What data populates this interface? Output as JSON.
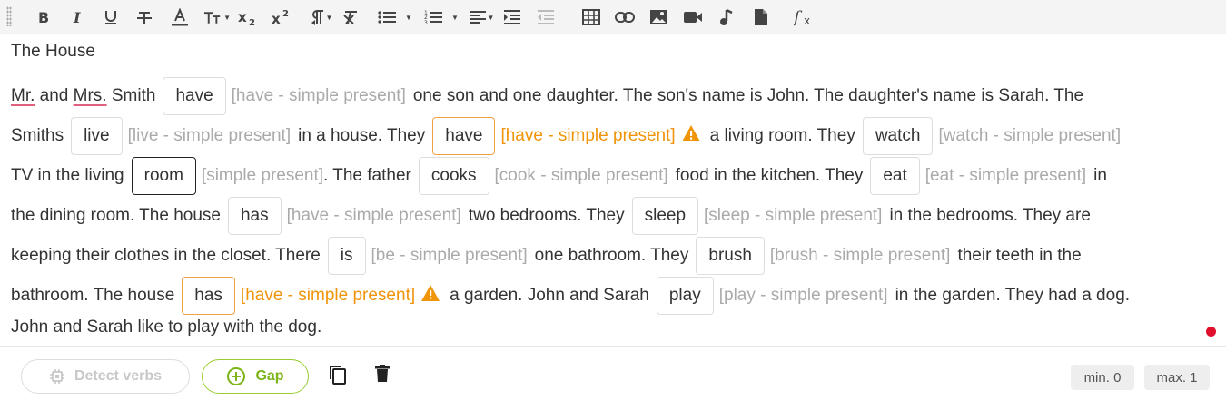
{
  "toolbar": {
    "items": [
      "bold-icon",
      "italic-icon",
      "underline-icon",
      "strikethrough-icon",
      "font-color-icon",
      "font-size-icon",
      "subscript-icon",
      "superscript-icon",
      "paragraph-format-icon",
      "clear-formatting-icon",
      "unordered-list-icon",
      "ordered-list-icon",
      "align-icon",
      "indent-icon",
      "outdent-icon",
      "table-icon",
      "link-icon",
      "image-icon",
      "video-icon",
      "audio-icon",
      "file-icon",
      "formula-icon"
    ]
  },
  "editor": {
    "title": "The House",
    "lines": [
      [
        {
          "t": "text",
          "v": "Mr.",
          "u": true
        },
        {
          "t": "text",
          "v": " and "
        },
        {
          "t": "text",
          "v": "Mrs.",
          "u": true
        },
        {
          "t": "text",
          "v": " Smith"
        },
        {
          "t": "gap",
          "v": "have"
        },
        {
          "t": "hint",
          "v": "[have - simple present]"
        },
        {
          "t": "text",
          "v": "one son and one daughter. The son's name is John. The daughter's name is Sarah. The"
        }
      ],
      [
        {
          "t": "text",
          "v": "Smiths"
        },
        {
          "t": "gap",
          "v": "live"
        },
        {
          "t": "hint",
          "v": "[live - simple present]"
        },
        {
          "t": "text",
          "v": "in a house. They"
        },
        {
          "t": "gap",
          "v": "have",
          "s": "orange"
        },
        {
          "t": "hint",
          "v": "[have - simple present]",
          "s": "orange"
        },
        {
          "t": "warn"
        },
        {
          "t": "text",
          "v": "a living room. They"
        },
        {
          "t": "gap",
          "v": "watch"
        },
        {
          "t": "hint",
          "v": "[watch - simple present]"
        }
      ],
      [
        {
          "t": "text",
          "v": "TV in the living"
        },
        {
          "t": "gap",
          "v": "room",
          "s": "focus"
        },
        {
          "t": "hint",
          "v": "[simple present]",
          "nm": true
        },
        {
          "t": "text",
          "v": ". The father"
        },
        {
          "t": "gap",
          "v": "cooks"
        },
        {
          "t": "hint",
          "v": "[cook - simple present]"
        },
        {
          "t": "text",
          "v": "food in the kitchen. They"
        },
        {
          "t": "gap",
          "v": "eat"
        },
        {
          "t": "hint",
          "v": "[eat - simple present]"
        },
        {
          "t": "text",
          "v": "in"
        }
      ],
      [
        {
          "t": "text",
          "v": "the dining room. The house"
        },
        {
          "t": "gap",
          "v": "has"
        },
        {
          "t": "hint",
          "v": "[have - simple present]"
        },
        {
          "t": "text",
          "v": "two bedrooms. They"
        },
        {
          "t": "gap",
          "v": "sleep"
        },
        {
          "t": "hint",
          "v": "[sleep - simple present]"
        },
        {
          "t": "text",
          "v": "in the bedrooms. They are"
        }
      ],
      [
        {
          "t": "text",
          "v": "keeping their clothes in the closet. There"
        },
        {
          "t": "gap",
          "v": "is"
        },
        {
          "t": "hint",
          "v": "[be - simple present]"
        },
        {
          "t": "text",
          "v": "one bathroom. They"
        },
        {
          "t": "gap",
          "v": "brush"
        },
        {
          "t": "hint",
          "v": "[brush - simple present]"
        },
        {
          "t": "text",
          "v": "their teeth in the"
        }
      ],
      [
        {
          "t": "text",
          "v": "bathroom. The house"
        },
        {
          "t": "gap",
          "v": "has",
          "s": "orange"
        },
        {
          "t": "hint",
          "v": "[have - simple present]",
          "s": "orange"
        },
        {
          "t": "warn"
        },
        {
          "t": "text",
          "v": "a garden. John and Sarah"
        },
        {
          "t": "gap",
          "v": "play"
        },
        {
          "t": "hint",
          "v": "[play - simple present]"
        },
        {
          "t": "text",
          "v": "in the garden. They had a dog."
        }
      ],
      [
        {
          "t": "text",
          "v": "John and Sarah like to play with the dog."
        }
      ]
    ]
  },
  "footer": {
    "detect_label": "Detect verbs",
    "gap_label": "Gap",
    "min_label": "min. 0",
    "max_label": "max. 1"
  },
  "colors": {
    "accent_green": "#7cb518",
    "warning_orange": "#f0940a",
    "marker_red": "#e0102c"
  }
}
